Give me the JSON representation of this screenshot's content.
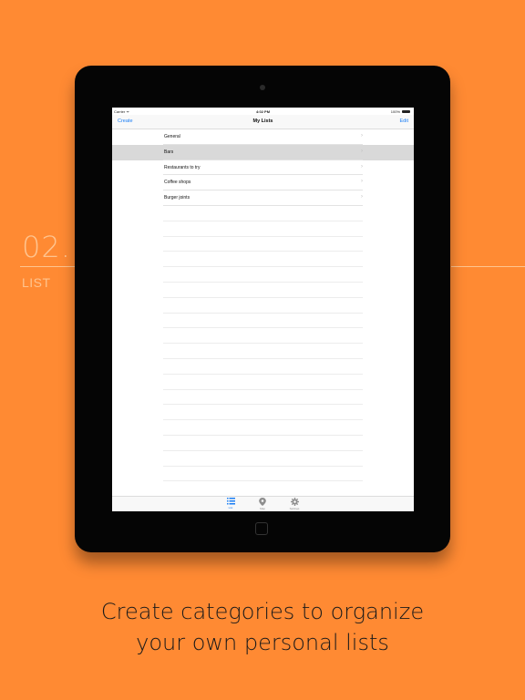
{
  "step": {
    "number": "02.",
    "label": "LIST"
  },
  "device": {
    "status_bar": {
      "carrier": "Carrier ᯤ",
      "time": "4:02 PM",
      "battery": "100%"
    },
    "nav_bar": {
      "left_button": "Create",
      "title": "My Lists",
      "right_button": "Edit"
    },
    "lists": [
      {
        "label": "General",
        "selected": false
      },
      {
        "label": "Bars",
        "selected": true
      },
      {
        "label": "Restaurants to try",
        "selected": false
      },
      {
        "label": "Coffee shops",
        "selected": false
      },
      {
        "label": "Burger joints",
        "selected": false
      }
    ],
    "tab_bar": [
      {
        "label": "List",
        "icon": "list-icon",
        "active": true
      },
      {
        "label": "Map",
        "icon": "map-pin-icon",
        "active": false
      },
      {
        "label": "Settings",
        "icon": "gear-icon",
        "active": false
      }
    ]
  },
  "caption": {
    "line1": "Create categories to organize",
    "line2": "your own personal lists"
  },
  "colors": {
    "background": "#FF8A33",
    "accent": "#1A7EF5",
    "step_text": "#FFC48F"
  }
}
